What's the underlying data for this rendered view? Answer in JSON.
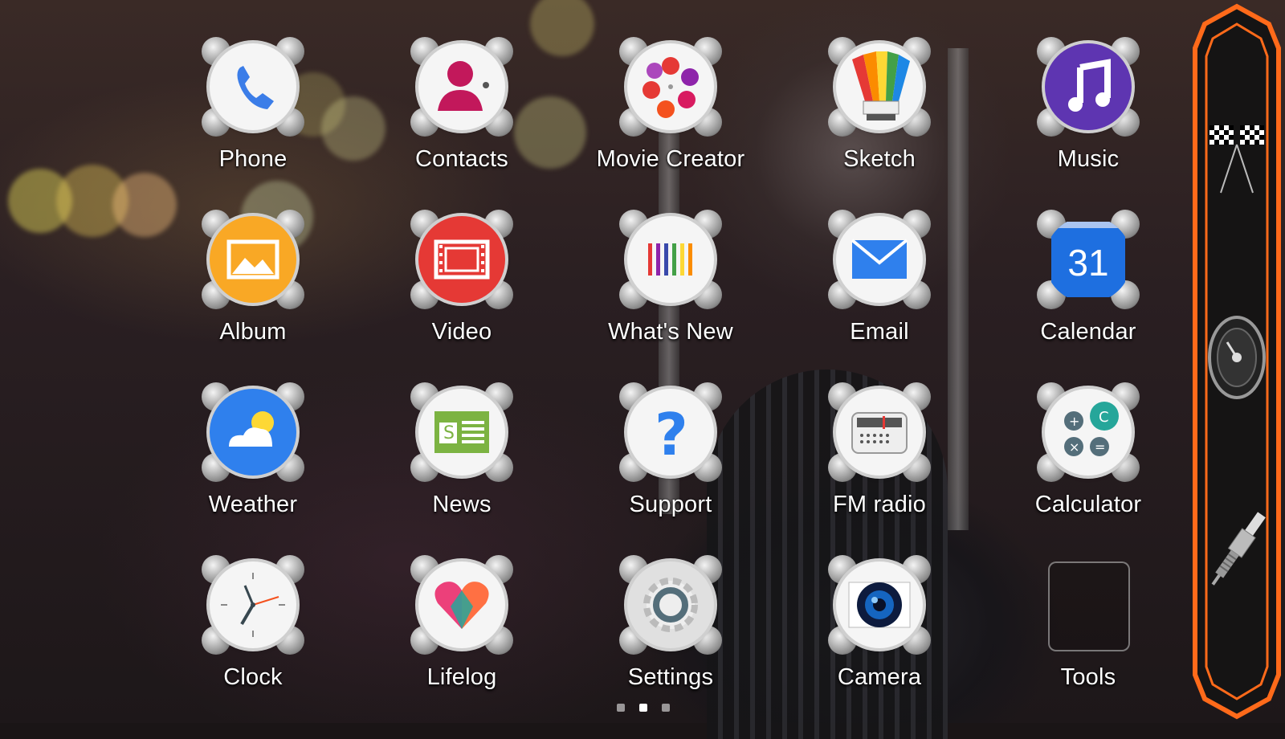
{
  "apps": [
    {
      "label": "Phone",
      "icon": "phone-icon"
    },
    {
      "label": "Contacts",
      "icon": "contacts-icon"
    },
    {
      "label": "Movie Creator",
      "icon": "movie-creator-icon"
    },
    {
      "label": "Sketch",
      "icon": "sketch-icon"
    },
    {
      "label": "Music",
      "icon": "music-icon"
    },
    {
      "label": "Album",
      "icon": "album-icon"
    },
    {
      "label": "Video",
      "icon": "video-icon"
    },
    {
      "label": "What's New",
      "icon": "whats-new-icon"
    },
    {
      "label": "Email",
      "icon": "email-icon"
    },
    {
      "label": "Calendar",
      "icon": "calendar-icon",
      "badge": "31"
    },
    {
      "label": "Weather",
      "icon": "weather-icon"
    },
    {
      "label": "News",
      "icon": "news-icon"
    },
    {
      "label": "Support",
      "icon": "support-icon"
    },
    {
      "label": "FM radio",
      "icon": "fm-radio-icon"
    },
    {
      "label": "Calculator",
      "icon": "calculator-icon"
    },
    {
      "label": "Clock",
      "icon": "clock-icon"
    },
    {
      "label": "Lifelog",
      "icon": "lifelog-icon"
    },
    {
      "label": "Settings",
      "icon": "settings-icon"
    },
    {
      "label": "Camera",
      "icon": "camera-icon"
    },
    {
      "label": "Tools",
      "icon": "folder-icon"
    }
  ],
  "dock": {
    "items": [
      "checkered-flags-icon",
      "speedometer-icon",
      "spark-plug-icon"
    ],
    "accent_color": "#ff6a1a"
  },
  "pager": {
    "pages": 3,
    "active": 1
  }
}
